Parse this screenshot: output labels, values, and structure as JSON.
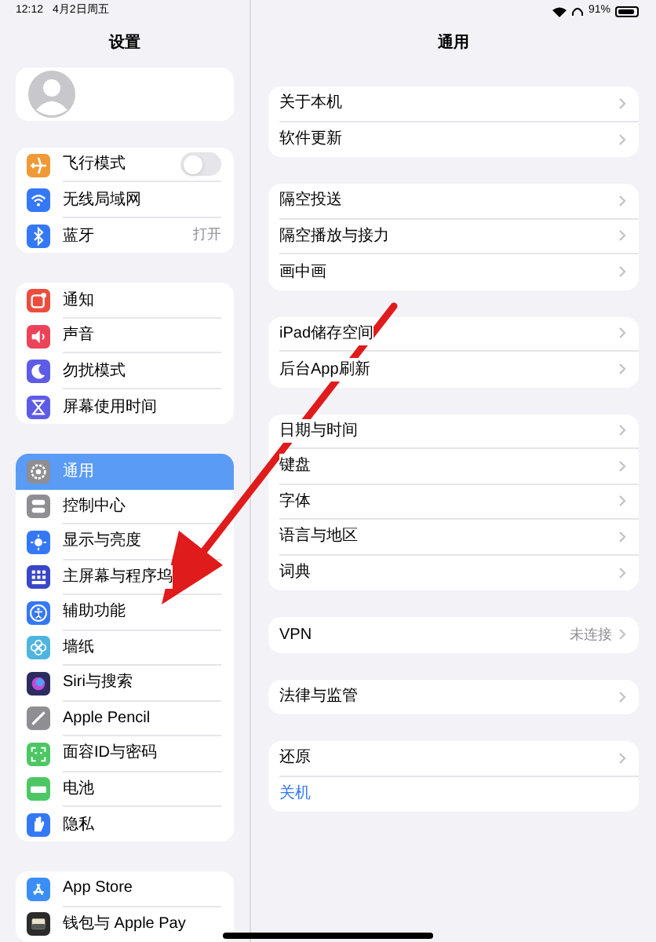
{
  "status_bar": {
    "time": "12:12",
    "date": "4月2日周五",
    "battery": "91%"
  },
  "sidebar": {
    "title": "设置",
    "groups": [
      {
        "items": [
          {
            "label": "飞行模式",
            "color": "#f09a37",
            "selected": false,
            "on": false
          },
          {
            "label": "无线局域网",
            "color": "#3478f6",
            "selected": false
          },
          {
            "label": "蓝牙",
            "color": "#3478f6",
            "selected": false,
            "value": "打开"
          }
        ]
      },
      {
        "items": [
          {
            "label": "通知",
            "color": "#eb4d3d",
            "selected": false
          },
          {
            "label": "声音",
            "color": "#eb445a",
            "selected": false
          },
          {
            "label": "勿扰模式",
            "color": "#5e5ce6",
            "selected": false
          },
          {
            "label": "屏幕使用时间",
            "color": "#5e5ce6",
            "selected": false
          }
        ]
      },
      {
        "items": [
          {
            "label": "通用",
            "color": "#8e8e93",
            "selected": true
          },
          {
            "label": "控制中心",
            "color": "#8e8e93",
            "selected": false
          },
          {
            "label": "显示与亮度",
            "color": "#3478f6",
            "selected": false
          },
          {
            "label": "主屏幕与程序坞",
            "color": "#3a46c8",
            "selected": false
          },
          {
            "label": "辅助功能",
            "color": "#3478f6",
            "selected": false
          },
          {
            "label": "墙纸",
            "color": "#4fb5e0",
            "selected": false
          },
          {
            "label": "Siri与搜索",
            "color": "#2c2c5e",
            "selected": false
          },
          {
            "label": "Apple Pencil",
            "color": "#8e8e93",
            "selected": false
          },
          {
            "label": "面容ID与密码",
            "color": "#4cc764",
            "selected": false
          },
          {
            "label": "电池",
            "color": "#4cc764",
            "selected": false
          },
          {
            "label": "隐私",
            "color": "#3478f6",
            "selected": false
          }
        ]
      },
      {
        "items": [
          {
            "label": "App Store",
            "color": "#3a8ef6",
            "selected": false
          },
          {
            "label": "钱包与 Apple Pay",
            "color": "#2b2b2b",
            "selected": false
          }
        ]
      }
    ]
  },
  "detail": {
    "title": "通用",
    "groups": [
      {
        "rows": [
          {
            "label": "关于本机",
            "kind": "link"
          },
          {
            "label": "软件更新",
            "kind": "link"
          }
        ]
      },
      {
        "rows": [
          {
            "label": "隔空投送",
            "kind": "link"
          },
          {
            "label": "隔空播放与接力",
            "kind": "link"
          },
          {
            "label": "画中画",
            "kind": "link"
          }
        ]
      },
      {
        "rows": [
          {
            "label": "iPad储存空间",
            "kind": "link"
          },
          {
            "label": "后台App刷新",
            "kind": "link"
          }
        ]
      },
      {
        "rows": [
          {
            "label": "日期与时间",
            "kind": "link"
          },
          {
            "label": "键盘",
            "kind": "link"
          },
          {
            "label": "字体",
            "kind": "link"
          },
          {
            "label": "语言与地区",
            "kind": "link"
          },
          {
            "label": "词典",
            "kind": "link"
          }
        ]
      },
      {
        "rows": [
          {
            "label": "VPN",
            "kind": "link",
            "value": "未连接"
          }
        ]
      },
      {
        "rows": [
          {
            "label": "法律与监管",
            "kind": "link"
          }
        ]
      },
      {
        "rows": [
          {
            "label": "还原",
            "kind": "link"
          },
          {
            "label": "关机",
            "kind": "action"
          }
        ]
      }
    ]
  }
}
